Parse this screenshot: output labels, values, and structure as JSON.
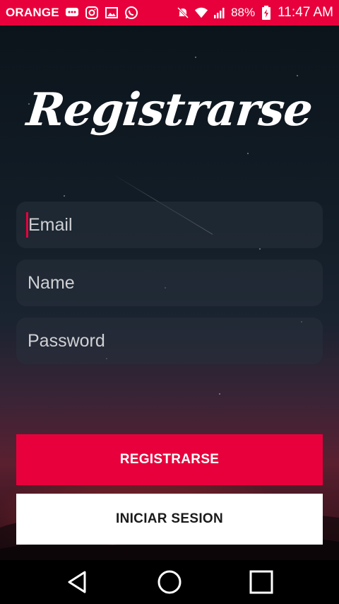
{
  "status_bar": {
    "carrier": "ORANGE",
    "battery": "88%",
    "time": "11:47 AM",
    "icons": [
      "message-icon",
      "instagram-icon",
      "gallery-icon",
      "whatsapp-icon",
      "mute-icon",
      "wifi-icon",
      "signal-icon",
      "battery-charging-icon"
    ]
  },
  "header": {
    "title": "Registrarse"
  },
  "form": {
    "email_placeholder": "Email",
    "name_placeholder": "Name",
    "password_placeholder": "Password"
  },
  "actions": {
    "register_label": "REGISTRARSE",
    "login_label": "INICIAR SESION"
  },
  "nav": {
    "icons": [
      "back-icon",
      "home-icon",
      "recents-icon"
    ]
  },
  "colors": {
    "accent": "#e8003c",
    "background": "#0d151c"
  }
}
